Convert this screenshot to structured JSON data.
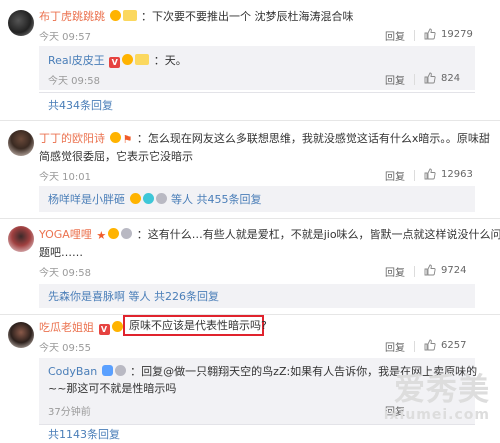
{
  "comments": [
    {
      "name": "布丁虎跳跳跳",
      "text": "：下次要不要推出一个 沈梦辰杜海涛混合味",
      "time": "今天 09:57",
      "reply_label": "回复",
      "likes": "19279",
      "reply": {
        "name": "Real皮皮王",
        "text": "：天。",
        "time": "今天 09:58",
        "reply_label": "回复",
        "likes": "824"
      },
      "more": "共434条回复"
    },
    {
      "name": "丁丁的欧阳诗",
      "text_line1": "：怎么现在网友这么多联想思维，我就没感觉这话有什么x暗示。。原味甜",
      "text_line2": "简感觉很委屈，它表示它没暗示",
      "time": "今天 10:01",
      "reply_label": "回复",
      "likes": "12963",
      "summary_name": "杨咩咩是小胖砸",
      "summary_rest": " 等人 共455条回复"
    },
    {
      "name": "YOGA哩哩",
      "text_line1": "：这有什么…有些人就是爱杠，不就是jio味么，皆默一点就这样说没什么问",
      "text_line2": "题吧……",
      "time": "今天 09:58",
      "reply_label": "回复",
      "likes": "9724",
      "summary_name": "先森你是喜脉啊",
      "summary_rest": " 等人 共226条回复"
    },
    {
      "name": "吃瓜老姐姐",
      "text": "原味不应该是代表性暗示吗?",
      "time": "今天 09:55",
      "reply_label": "回复",
      "likes": "6257",
      "reply": {
        "name": "CodyBan",
        "text_line1": "：回复@做一只翱翔天空的鸟zZ:如果有人告诉你，我是在网上卖原味的",
        "text_line2": "~~那这可不就是性暗示吗",
        "time": "37分钟前",
        "reply_label": "回复"
      },
      "more": "共1143条回复"
    }
  ],
  "watermark": {
    "cn": "爱秀美",
    "en": "ixiumei.com"
  },
  "colors": {
    "name": "#eb7350",
    "link": "#4a7eb8",
    "highlight": "#e0232d"
  }
}
